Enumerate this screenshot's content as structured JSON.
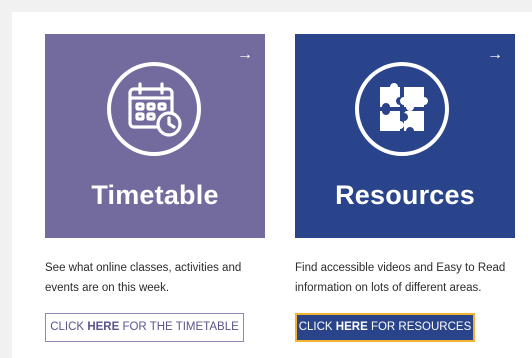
{
  "colors": {
    "timetable_tile": "#736a9d",
    "resources_tile": "#29448a",
    "resources_button_border": "#f2b233"
  },
  "tiles": [
    {
      "title": "Timetable",
      "icon": "calendar-clock-icon",
      "arrow": "→",
      "description": "See what online classes, activities and events are on this week.",
      "button": {
        "prefix": "CLICK ",
        "strong": "HERE",
        "suffix": " FOR THE TIMETABLE"
      }
    },
    {
      "title": "Resources",
      "icon": "puzzle-pieces-icon",
      "arrow": "→",
      "description": "Find accessible videos and Easy to Read information on lots of different areas.",
      "button": {
        "prefix": "CLICK ",
        "strong": "HERE",
        "suffix": " FOR RESOURCES"
      }
    }
  ]
}
